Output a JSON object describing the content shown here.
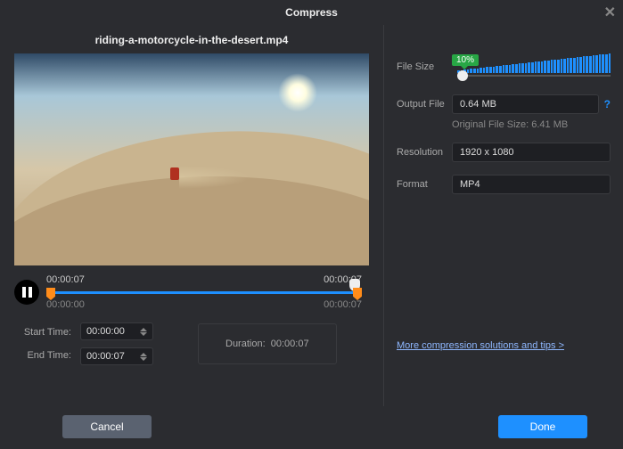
{
  "title": "Compress",
  "filename": "riding-a-motorcycle-in-the-desert.mp4",
  "timeline": {
    "current": "00:00:07",
    "total": "00:00:07",
    "start_scale": "00:00:00",
    "end_scale": "00:00:07"
  },
  "time_controls": {
    "start_label": "Start Time:",
    "start_value": "00:00:00",
    "end_label": "End Time:",
    "end_value": "00:00:07",
    "duration_label": "Duration:",
    "duration_value": "00:00:07"
  },
  "settings": {
    "filesize_label": "File Size",
    "filesize_percent": "10%",
    "output_label": "Output File",
    "output_value": "0.64 MB",
    "original_hint": "Original File Size: 6.41 MB",
    "resolution_label": "Resolution",
    "resolution_value": "1920 x 1080",
    "format_label": "Format",
    "format_value": "MP4"
  },
  "link_text": "More compression solutions and tips >",
  "buttons": {
    "cancel": "Cancel",
    "done": "Done"
  }
}
